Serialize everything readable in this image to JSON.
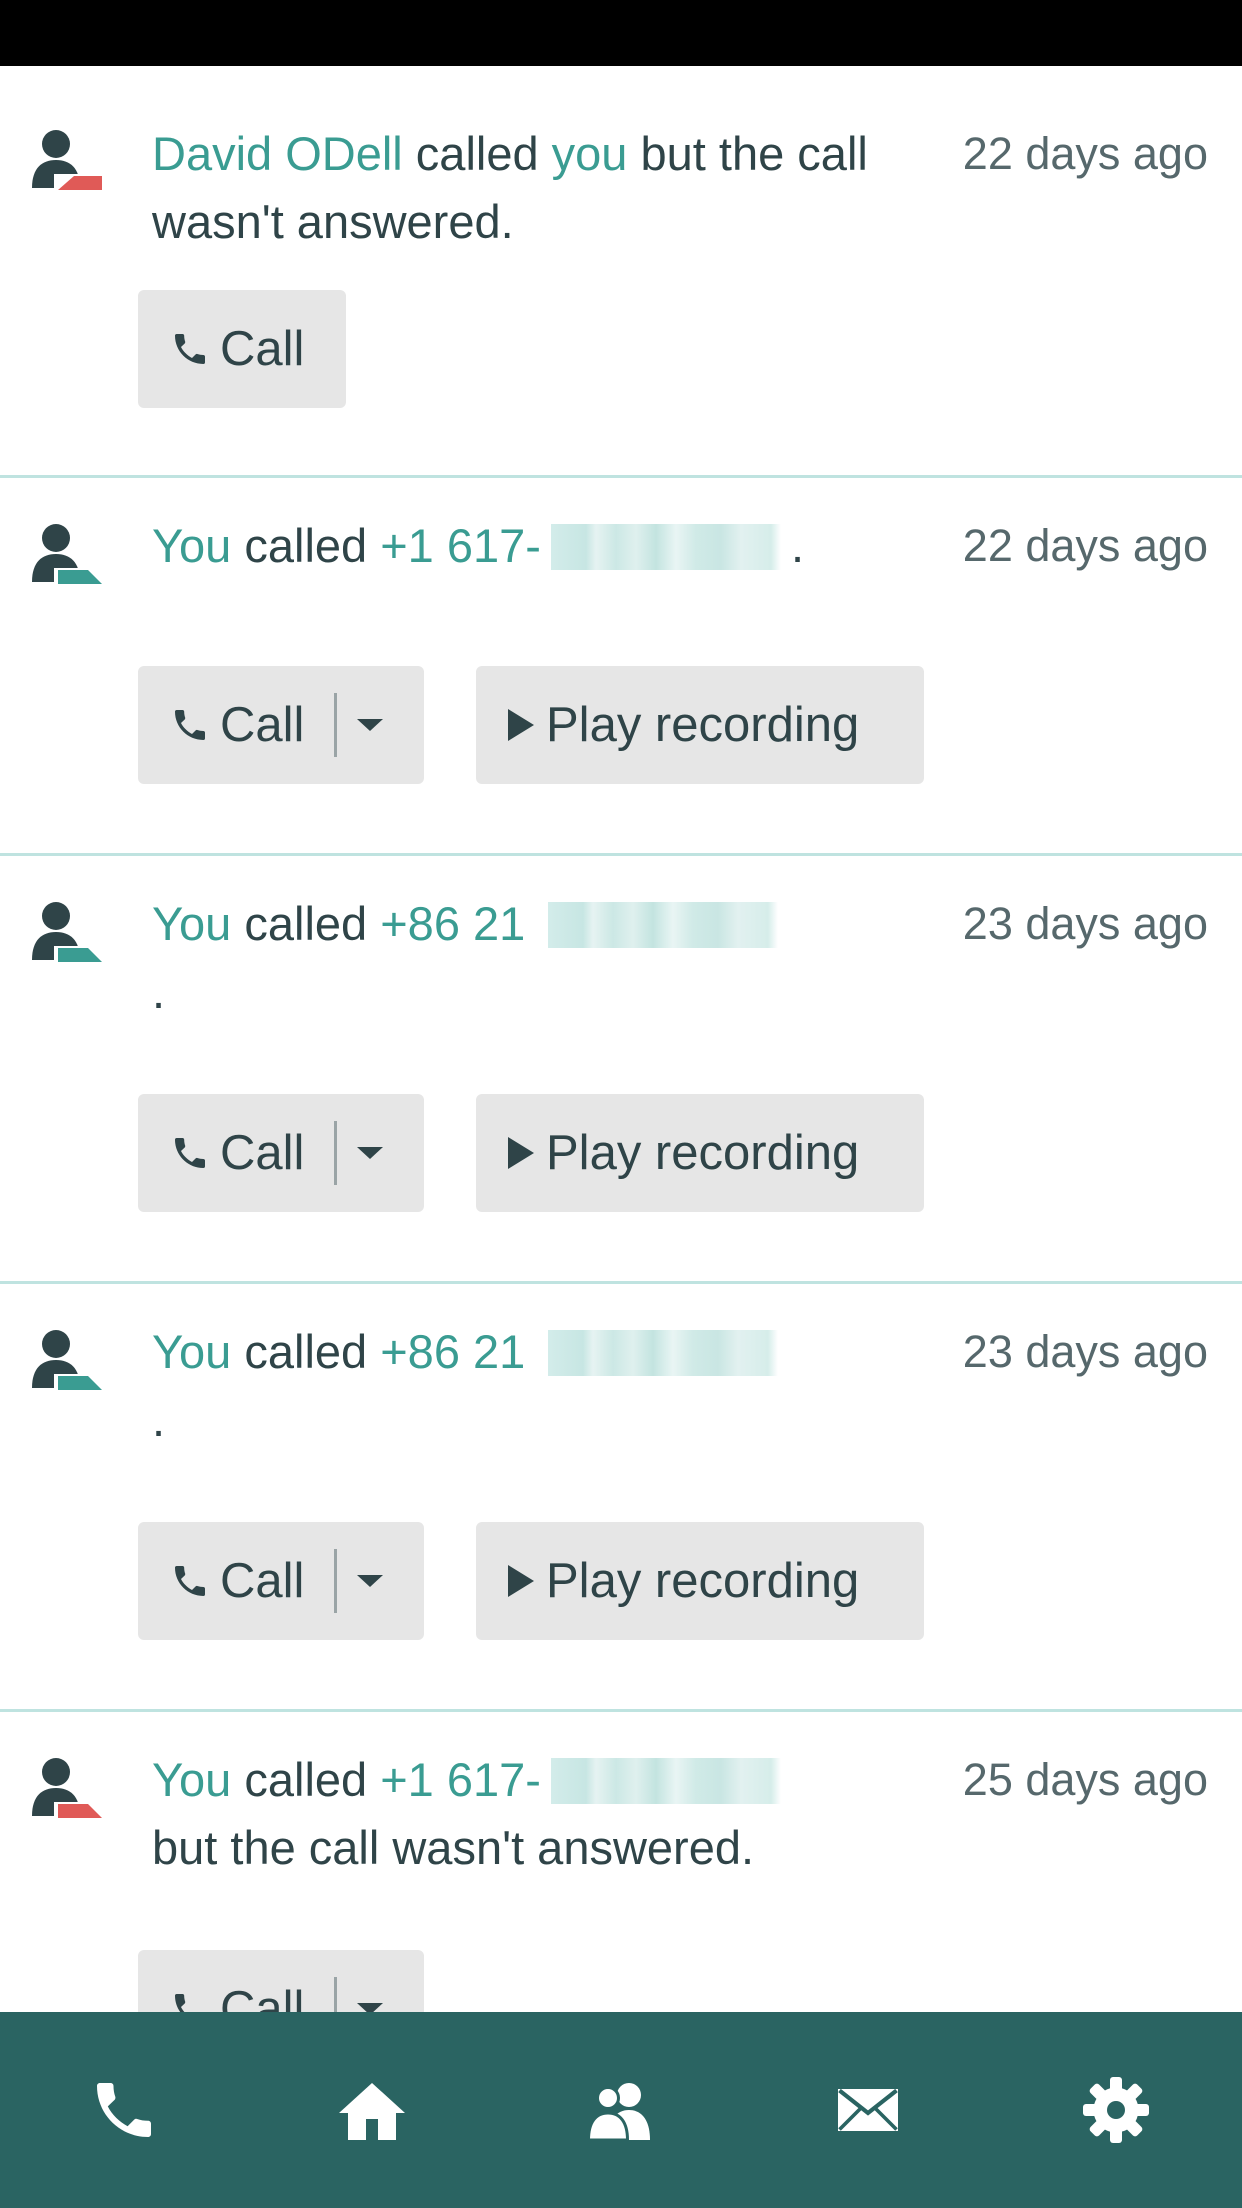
{
  "colors": {
    "accent": "#3a9c92",
    "missed": "#e05a57",
    "tabbar": "#2a6462",
    "text": "#2f4448",
    "button": "#e6e6e6"
  },
  "calls": [
    {
      "direction": "incoming-missed",
      "parts": [
        "David ODell",
        " called ",
        "you",
        " but the call wasn't answered."
      ],
      "time": "22 days ago",
      "call_label": "Call"
    },
    {
      "direction": "outgoing",
      "parts": [
        "You",
        " called ",
        "+1 617-",
        "."
      ],
      "time": "22 days ago",
      "call_label": "Call",
      "play_label": "Play recording"
    },
    {
      "direction": "outgoing",
      "parts": [
        "You",
        " called ",
        "+86 21",
        "."
      ],
      "time": "23 days ago",
      "call_label": "Call",
      "play_label": "Play recording"
    },
    {
      "direction": "outgoing",
      "parts": [
        "You",
        " called ",
        "+86 21",
        "."
      ],
      "time": "23 days ago",
      "call_label": "Call",
      "play_label": "Play recording"
    },
    {
      "direction": "outgoing-missed",
      "parts": [
        "You",
        " called ",
        "+1 617-",
        " but the call wasn't answered."
      ],
      "time": "25 days ago",
      "call_label": "Call"
    }
  ],
  "tabbar": {
    "tabs": [
      {
        "icon": "phone-icon"
      },
      {
        "icon": "home-icon"
      },
      {
        "icon": "contacts-icon"
      },
      {
        "icon": "mail-icon"
      },
      {
        "icon": "settings-icon"
      }
    ]
  }
}
